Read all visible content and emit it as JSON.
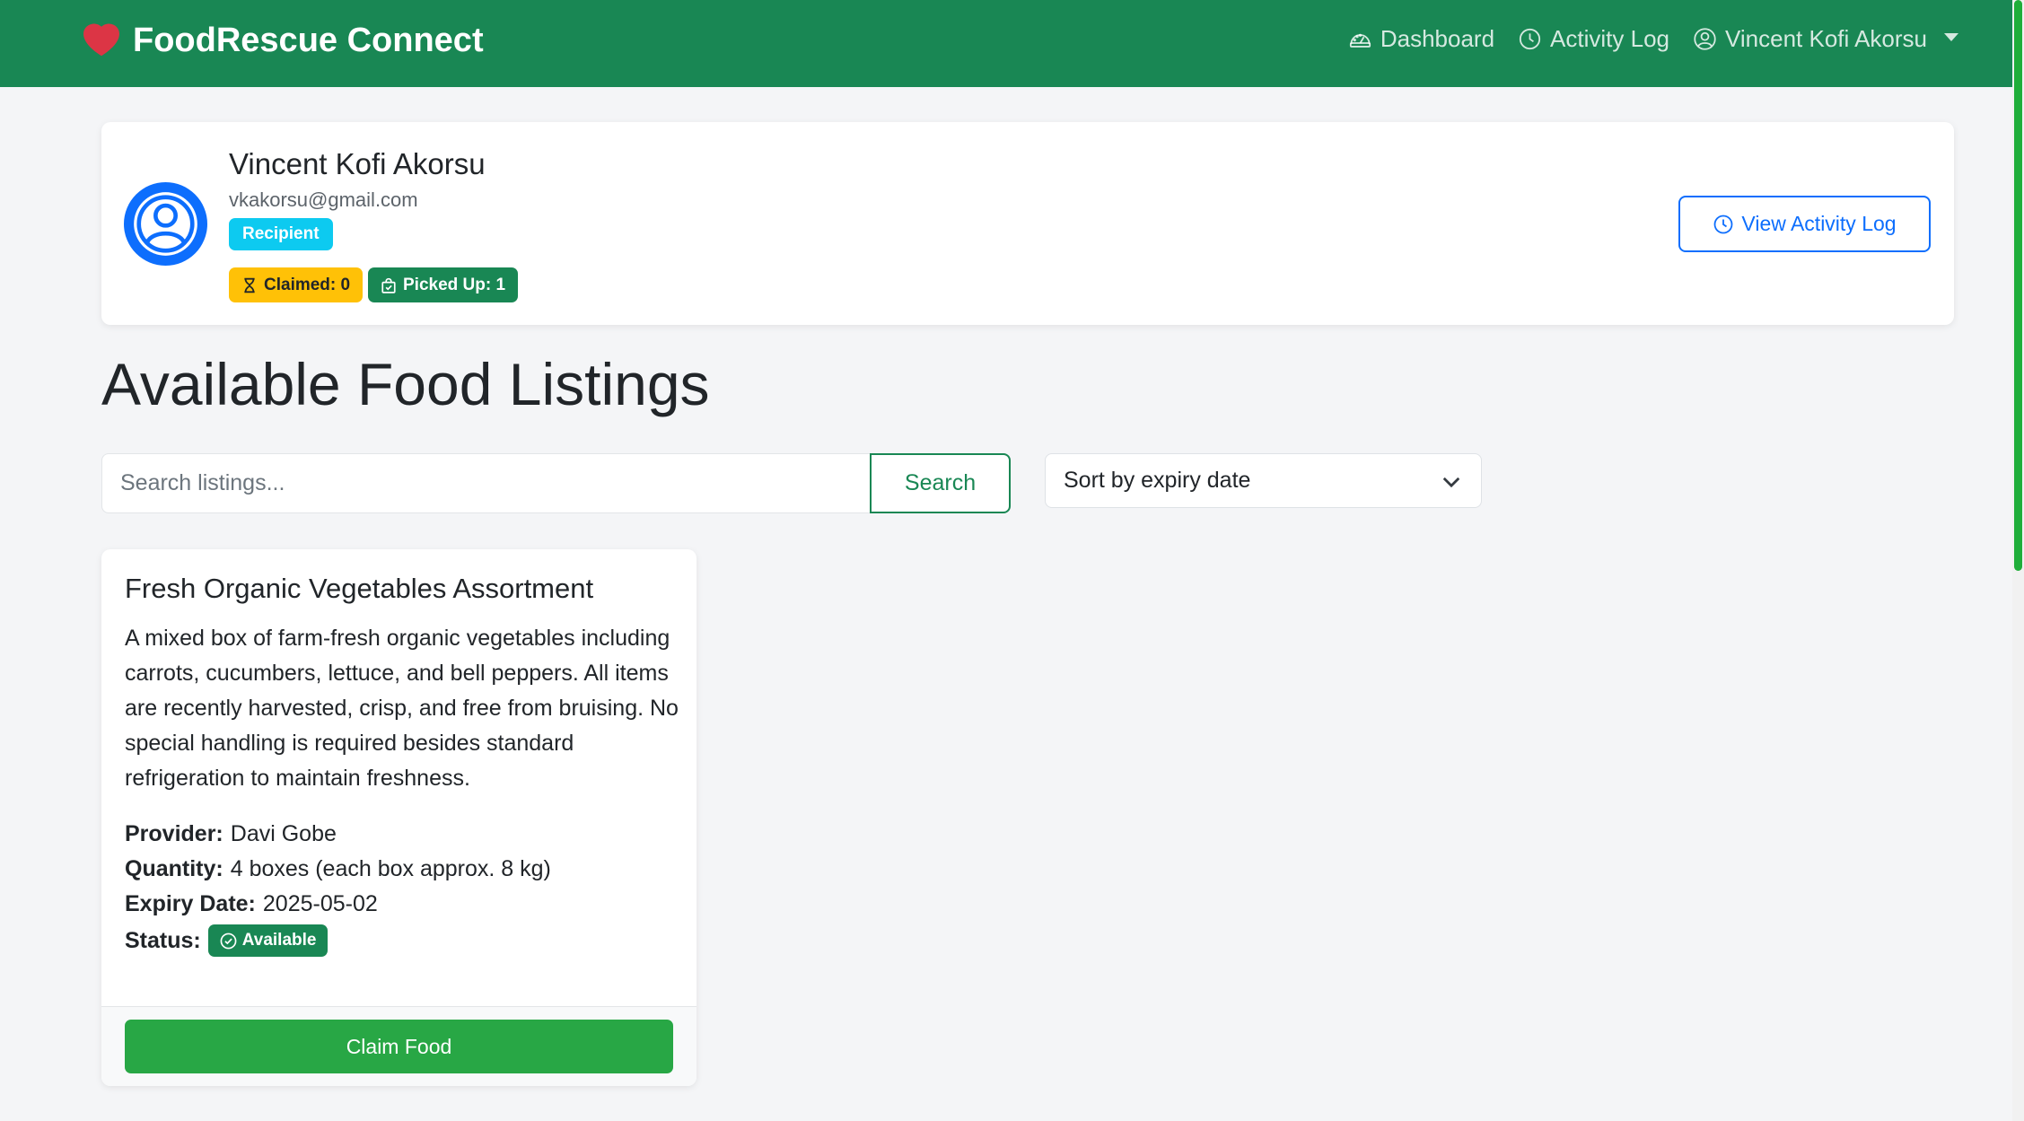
{
  "nav": {
    "brand": "FoodRescue Connect",
    "dashboard": "Dashboard",
    "activity_log": "Activity Log",
    "user_name": "Vincent Kofi Akorsu"
  },
  "profile": {
    "name": "Vincent Kofi Akorsu",
    "email": "vkakorsu@gmail.com",
    "role": "Recipient",
    "claimed": "Claimed: 0",
    "picked_up": "Picked Up: 1",
    "activity_button": "View Activity Log"
  },
  "main": {
    "title": "Available Food Listings",
    "search_placeholder": "Search listings...",
    "search_button": "Search",
    "sort_selected": "Sort by expiry date"
  },
  "listing": {
    "title": "Fresh Organic Vegetables Assortment",
    "description": "A mixed box of farm-fresh organic vegetables including carrots, cucumbers, lettuce, and bell peppers. All items are recently harvested, crisp, and free from bruising. No special handling is required besides standard refrigeration to maintain freshness.",
    "provider_label": "Provider:",
    "provider": "Davi Gobe",
    "quantity_label": "Quantity:",
    "quantity": "4 boxes (each box approx. 8 kg)",
    "expiry_label": "Expiry Date:",
    "expiry": "2025-05-02",
    "status_label": "Status:",
    "status": "Available",
    "claim_button": "Claim Food"
  },
  "colors": {
    "navbar": "#198754",
    "heart": "#dc3545",
    "recipient_badge": "#0dcaf0",
    "claimed_badge": "#ffc107",
    "picked_badge": "#198754",
    "claim_button": "#28a745",
    "activity_button": "#0d6efd"
  },
  "icons": {
    "brand": "heart-icon",
    "dashboard": "speedometer-icon",
    "activity": "clock-history-icon",
    "user": "person-circle-icon",
    "claimed": "hourglass-icon",
    "picked": "bag-check-icon",
    "status": "check-circle-icon",
    "sort": "chevron-down-icon"
  }
}
